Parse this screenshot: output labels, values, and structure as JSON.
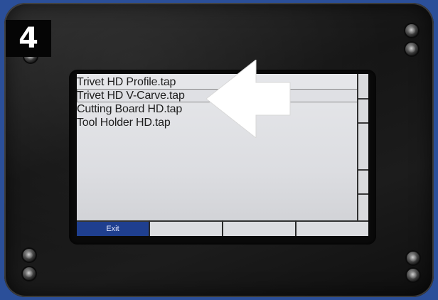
{
  "step": {
    "number": "4"
  },
  "screen": {
    "files": [
      {
        "label": "Trivet HD Profile.tap",
        "selected": false
      },
      {
        "label": "Trivet HD V-Carve.tap",
        "selected": true
      },
      {
        "label": "Cutting Board HD.tap",
        "selected": false
      },
      {
        "label": "Tool Holder HD.tap",
        "selected": false
      }
    ],
    "softkeys": [
      {
        "label": "Exit",
        "active": true
      },
      {
        "label": "",
        "active": false
      },
      {
        "label": "",
        "active": false
      },
      {
        "label": "",
        "active": false
      }
    ]
  },
  "colors": {
    "background": "#2b4f99",
    "softkey_active": "#1f3f8f",
    "arrow": "#ffffff"
  },
  "icons": {
    "pointer": "left-arrow-icon",
    "fasteners": "screw-icon"
  }
}
